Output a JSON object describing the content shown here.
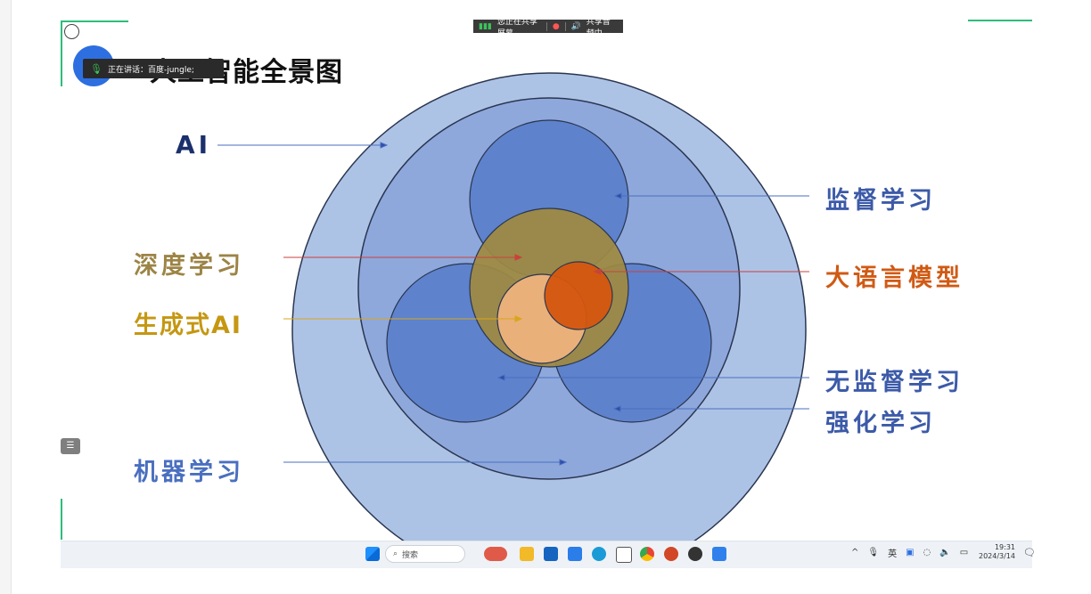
{
  "share_bar": {
    "text": "您正在共享屏幕",
    "audio": "共享音频中"
  },
  "speaking": {
    "text": "正在讲话：百度-jungle;"
  },
  "slide": {
    "title": "人工智能全景图",
    "labels": {
      "ai": "AI",
      "supervised": "监督学习",
      "deep_learning": "深度学习",
      "llm": "大语言模型",
      "generative_ai": "生成式AI",
      "unsupervised": "无监督学习",
      "reinforcement": "强化学习",
      "machine_learning": "机器学习"
    },
    "colors": {
      "ai_label": "#1a2f6b",
      "ml_blue": "#4a6fc0",
      "deep_learning": "#9c8446",
      "llm": "#d05a14",
      "generative": "#c59712",
      "outer_circle": "#adc3e6",
      "ml_circle": "#8ea8dc",
      "sub_circle": "#5e82cc",
      "deep_circle": "#a08a40",
      "gen_circle": "#e9b07a",
      "llm_circle": "#d4560f"
    }
  },
  "taskbar": {
    "search_placeholder": "搜索",
    "time": "19:31",
    "date": "2024/3/14",
    "tray_ime": "英"
  }
}
